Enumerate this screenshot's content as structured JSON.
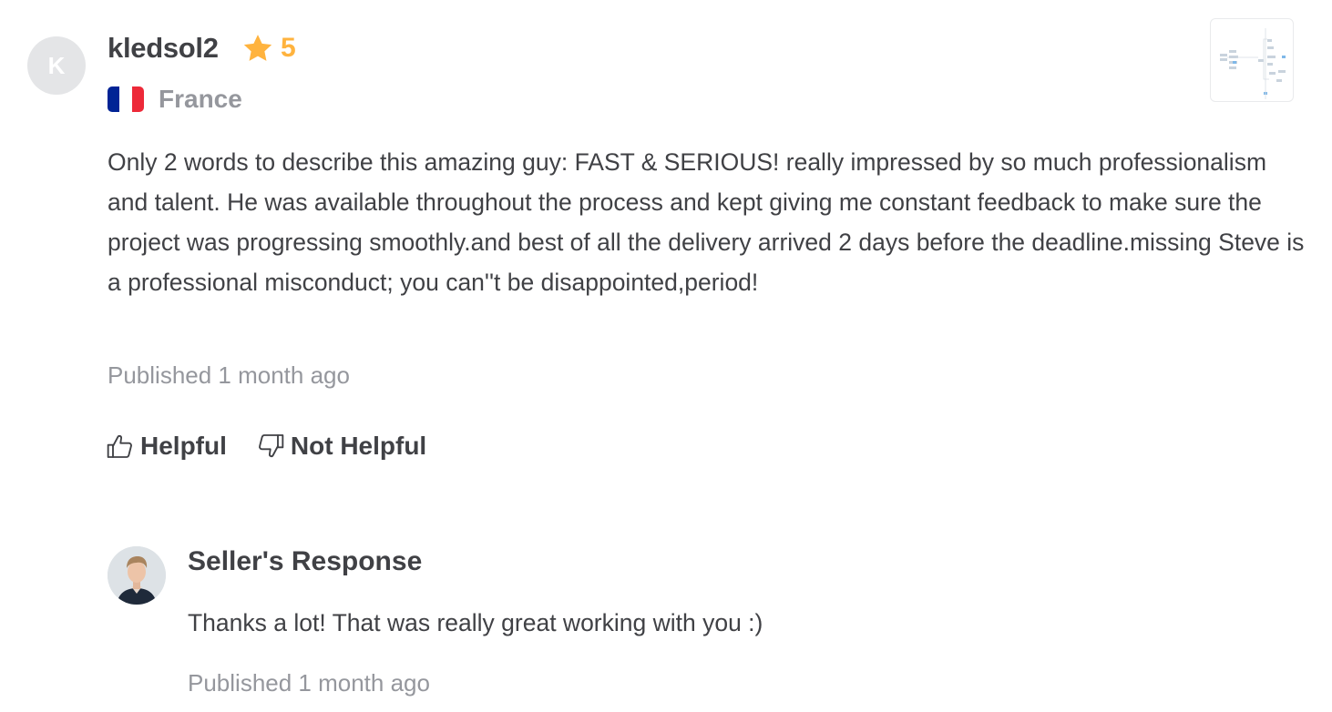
{
  "reviewer": {
    "initial": "K",
    "name": "kledsol2",
    "rating": "5",
    "country": "France"
  },
  "review": {
    "text": "Only 2 words to describe this amazing guy: FAST & SERIOUS! really impressed by so much professionalism and talent. He was available throughout the process and kept giving me constant feedback to make sure the project was progressing smoothly.and best of all the delivery arrived 2 days before the deadline.missing Steve is a professional misconduct; you can''t be disappointed,period!",
    "published": "Published 1 month ago"
  },
  "votes": {
    "helpful_label": "Helpful",
    "not_helpful_label": "Not Helpful"
  },
  "seller_response": {
    "title": "Seller's Response",
    "text": "Thanks a lot! That was really great working with you :)",
    "published": "Published 1 month ago"
  },
  "icons": {
    "rating": "star-icon",
    "flag": "flag-france-icon",
    "helpful": "thumbs-up-icon",
    "not_helpful": "thumbs-down-icon"
  },
  "colors": {
    "star": "#ffb33e",
    "text": "#404145",
    "muted": "#95979d",
    "avatar_bg": "#e4e5e7",
    "flag_blue": "#002395",
    "flag_white": "#ffffff",
    "flag_red": "#ed2939"
  }
}
